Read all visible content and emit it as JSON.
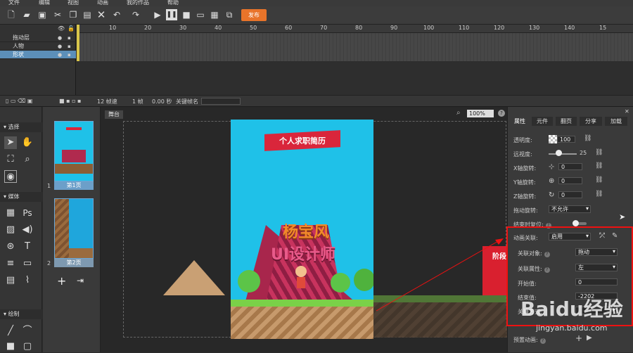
{
  "menu": [
    "文件",
    "编辑",
    "视图",
    "动画",
    "我的作品",
    "帮助"
  ],
  "toolbar": {
    "publish_label": "发布",
    "undo": "↶",
    "redo": "↷",
    "play": "▶",
    "pause": "❚❚"
  },
  "timeline": {
    "layers": [
      "拖动层",
      "人物",
      "形状"
    ],
    "ticks": [
      "10",
      "20",
      "30",
      "40",
      "50",
      "60",
      "70",
      "80",
      "90",
      "100",
      "110",
      "120",
      "130",
      "140",
      "15"
    ]
  },
  "tlstatus": {
    "fps": "12 帧速",
    "frame": "1 帧",
    "time": "0.00 秒",
    "keyframe": "关键帧名"
  },
  "left": {
    "select": "选择",
    "media": "媒体",
    "draw": "绘制",
    "ps": "Ps",
    "text": "T"
  },
  "pages": [
    {
      "label": "第1页",
      "num": "1"
    },
    {
      "label": "第2页",
      "num": "2"
    }
  ],
  "stage": {
    "tab": "舞台",
    "zoom": "100%",
    "banner": "个人求职简历",
    "name": "杨宝风",
    "title": "UI设计师",
    "side_sign": "阶段"
  },
  "right": {
    "tabs": [
      "属性",
      "元件",
      "翻页",
      "分享",
      "加载"
    ],
    "opacity_label": "透明度:",
    "opacity_value": "100",
    "shrink_label": "远视度:",
    "shrink_value": "25",
    "xrot_label": "X轴旋转:",
    "xrot_value": "0",
    "yrot_label": "Y轴旋转:",
    "yrot_value": "0",
    "zrot_label": "Z轴旋转:",
    "zrot_value": "0",
    "drag_label": "拖动旋转:",
    "drag_value": "不允许",
    "reset_label": "结束时复位:",
    "anim_label": "动画关联:",
    "anim_value": "启用",
    "target_label": "关联对象:",
    "target_value": "拖动",
    "attr_label": "关联属性:",
    "attr_value": "左",
    "start_label": "开始值:",
    "start_value": "0",
    "end_label": "结束值:",
    "end_value": "-2202",
    "extra_label": "关联方式:",
    "preset_label": "预置动画:"
  },
  "watermark": {
    "brand": "Baidu经验",
    "url": "jingyan.baidu.com"
  },
  "colors": {
    "publish": "#e8742a",
    "accent": "#6c9fc9",
    "highlight": "#e11111",
    "stage_bg": "#1fc1e8"
  }
}
